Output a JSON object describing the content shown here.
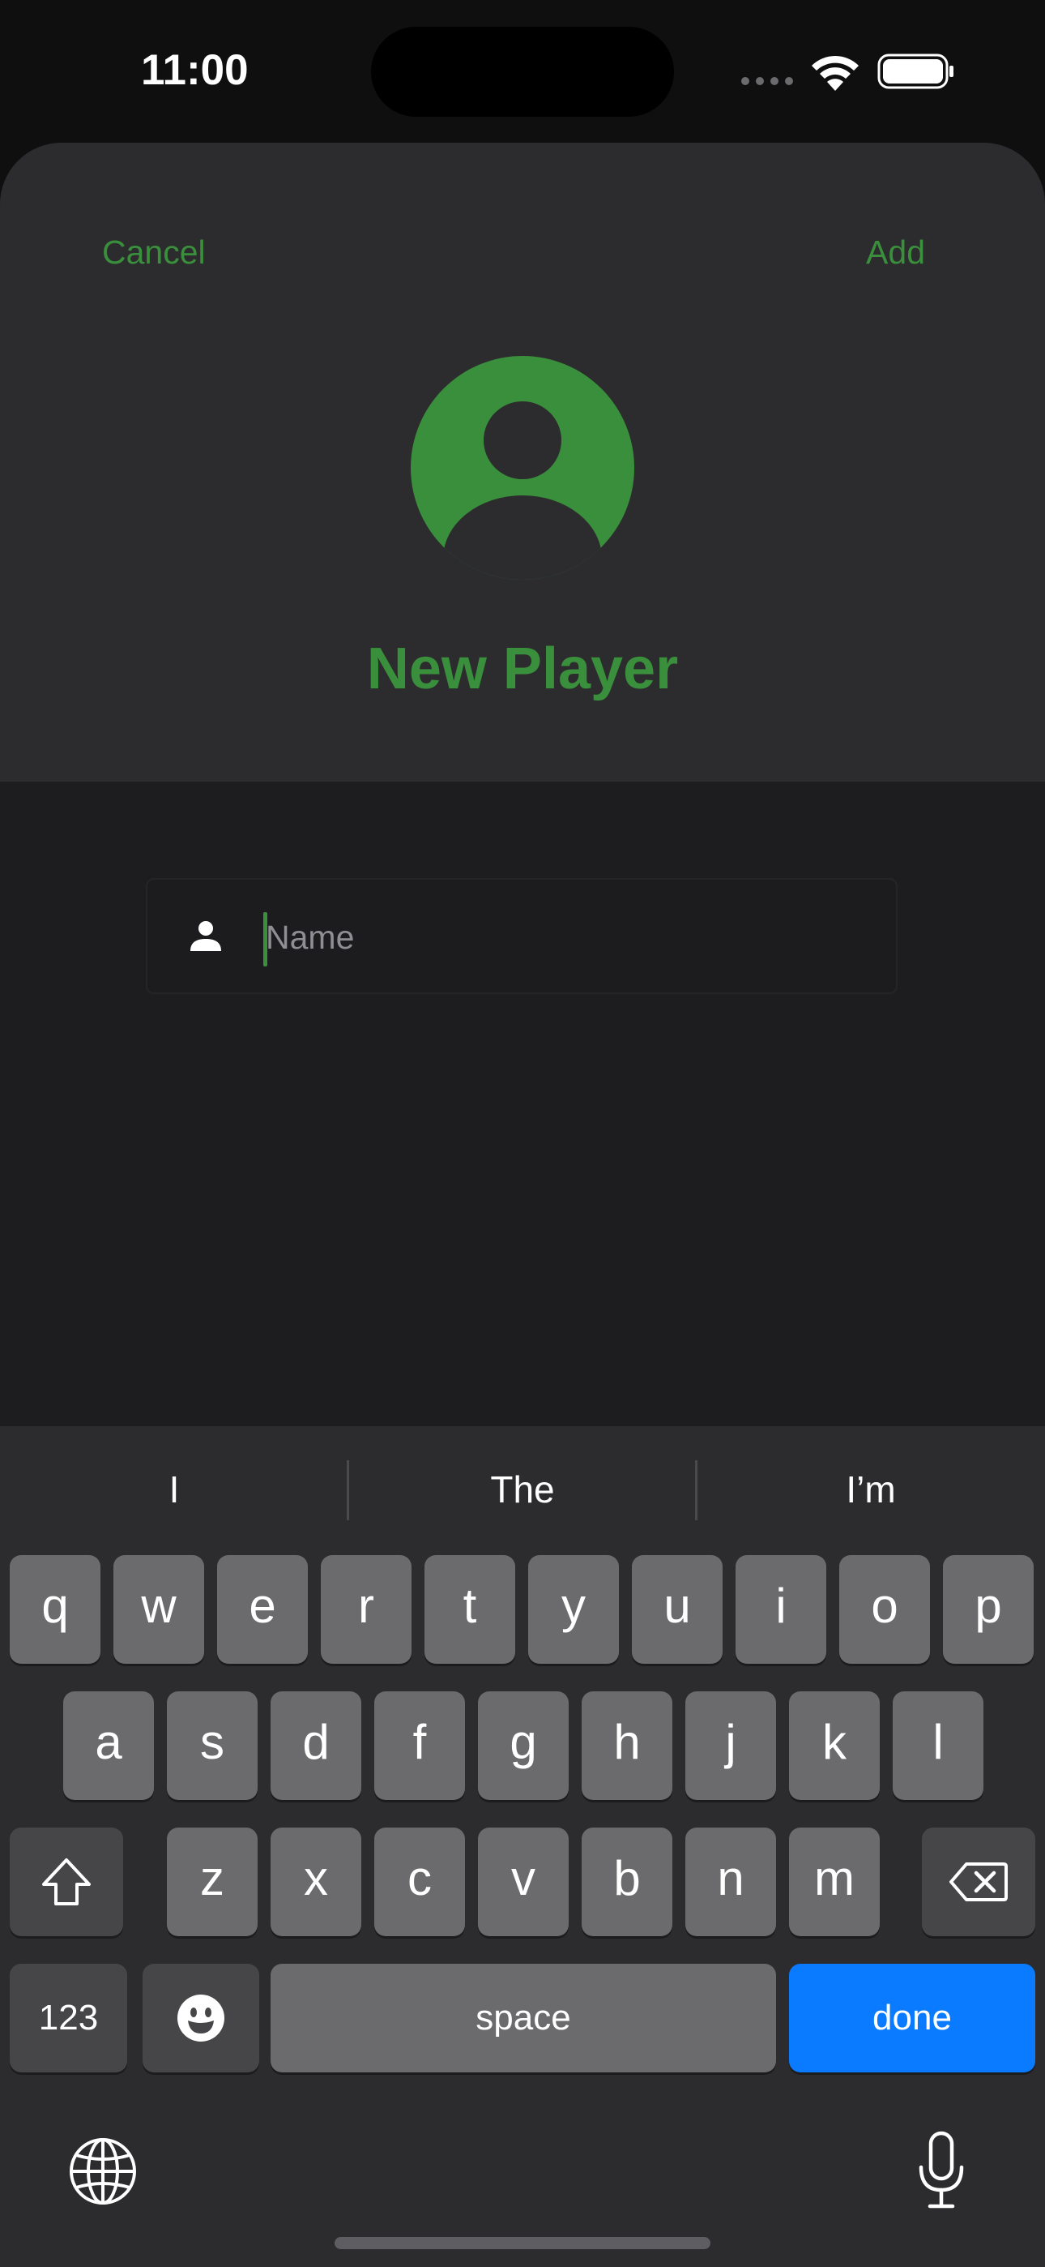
{
  "status_bar": {
    "time": "11:00"
  },
  "nav": {
    "cancel": "Cancel",
    "add": "Add"
  },
  "header": {
    "title": "New Player"
  },
  "name_field": {
    "placeholder": "Name",
    "value": ""
  },
  "keyboard": {
    "suggestions": [
      "I",
      "The",
      "I’m"
    ],
    "row1": [
      "q",
      "w",
      "e",
      "r",
      "t",
      "y",
      "u",
      "i",
      "o",
      "p"
    ],
    "row2": [
      "a",
      "s",
      "d",
      "f",
      "g",
      "h",
      "j",
      "k",
      "l"
    ],
    "row3": [
      "z",
      "x",
      "c",
      "v",
      "b",
      "n",
      "m"
    ],
    "numbers_label": "123",
    "space_label": "space",
    "done_label": "done"
  },
  "colors": {
    "accent": "#3a8f3c",
    "done_key": "#0a7aff",
    "sheet_header": "#2c2c2e",
    "sheet_body": "#1d1d1f"
  }
}
